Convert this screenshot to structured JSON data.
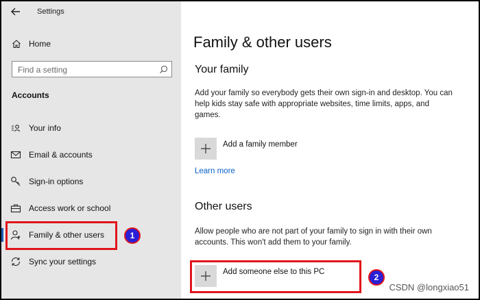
{
  "window": {
    "title": "Settings"
  },
  "sidebar": {
    "home_label": "Home",
    "search_placeholder": "Find a setting",
    "section_heading": "Accounts",
    "items": [
      {
        "label": "Your info",
        "icon": "person-card-icon"
      },
      {
        "label": "Email & accounts",
        "icon": "mail-icon"
      },
      {
        "label": "Sign-in options",
        "icon": "key-icon"
      },
      {
        "label": "Access work or school",
        "icon": "briefcase-icon"
      },
      {
        "label": "Family & other users",
        "icon": "person-add-icon",
        "selected": true
      },
      {
        "label": "Sync your settings",
        "icon": "sync-icon"
      }
    ]
  },
  "main": {
    "title": "Family & other users",
    "your_family": {
      "heading": "Your family",
      "description": "Add your family so everybody gets their own sign-in and desktop. You can help kids stay safe with appropriate websites, time limits, apps, and games.",
      "add_label": "Add a family member",
      "learn_more": "Learn more"
    },
    "other_users": {
      "heading": "Other users",
      "description": "Allow people who are not part of your family to sign in with their own accounts. This won't add them to your family.",
      "add_label": "Add someone else to this PC"
    }
  },
  "annotations": {
    "badge_1": "1",
    "badge_2": "2",
    "color": "#e0151b",
    "badge_color": "#2a1fd6"
  },
  "watermark": "CSDN @longxiao51",
  "colors": {
    "accent": "#1a5fb4",
    "link": "#0a5fc4",
    "sidebar_bg": "#e6e6e6"
  }
}
